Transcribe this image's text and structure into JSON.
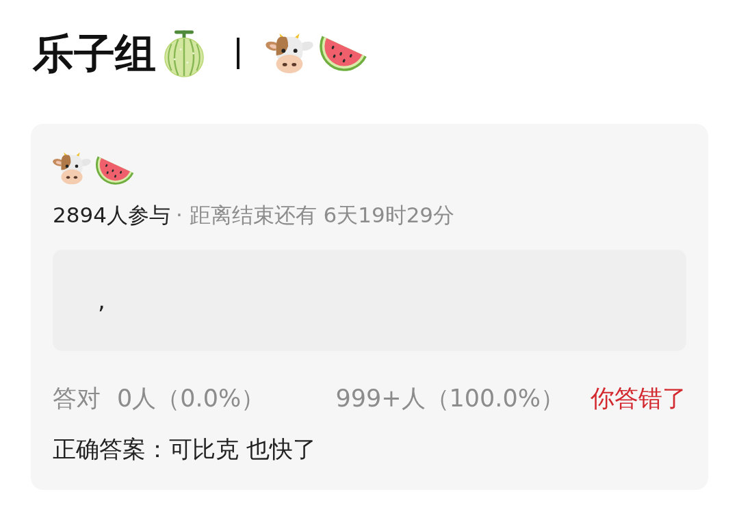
{
  "title": {
    "text": "乐子组"
  },
  "poll": {
    "participants": "2894人参与",
    "deadline": "· 距离结束还有 6天19时29分",
    "options": [
      {
        "text": ","
      }
    ],
    "results": {
      "correct_label": "答对",
      "correct_count": "0人（0.0%）",
      "wrong_count": "999+人（100.0%）",
      "verdict": {
        "text": "你答错了",
        "correct": false
      }
    },
    "answer": "正确答案：可比克 也快了"
  }
}
